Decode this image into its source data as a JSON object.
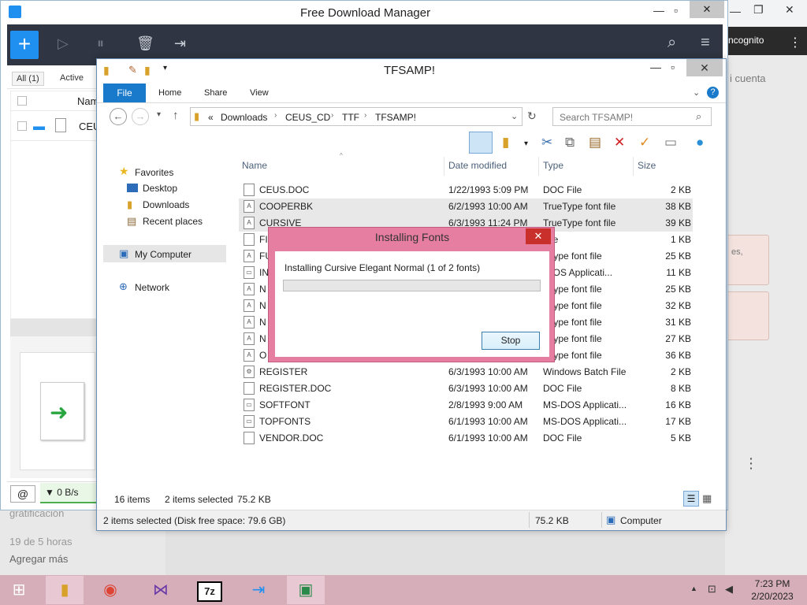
{
  "background": {
    "incognito_label": "ncognito",
    "cuenta_text": "i cuenta",
    "card_comma": "es,",
    "left_text1": "gratificación",
    "left_text2": "19 de 5 horas",
    "left_text3": "Agregar más"
  },
  "fdm": {
    "title": "Free Download Manager",
    "tabs": [
      "All (1)",
      "Active"
    ],
    "column_name": "Nam",
    "download_name": "CEU",
    "speed": "▼ 0 B/s"
  },
  "explorer": {
    "title": "TFSAMP!",
    "ribbon_tabs": {
      "file": "File",
      "home": "Home",
      "share": "Share",
      "view": "View"
    },
    "breadcrumb": [
      "«",
      "Downloads",
      "CEUS_CD",
      "TTF",
      "TFSAMP!"
    ],
    "search_placeholder": "Search TFSAMP!",
    "nav": {
      "favorites": "Favorites",
      "desktop": "Desktop",
      "downloads": "Downloads",
      "recent": "Recent places",
      "computer": "My Computer",
      "network": "Network"
    },
    "columns": {
      "name": "Name",
      "date": "Date modified",
      "type": "Type",
      "size": "Size"
    },
    "files": [
      {
        "name": "CEUS.DOC",
        "date": "1/22/1993 5:09 PM",
        "type": "DOC File",
        "size": "2 KB",
        "selected": false,
        "icon": "doc"
      },
      {
        "name": "COOPERBK",
        "date": "6/2/1993 10:00 AM",
        "type": "TrueType font file",
        "size": "38 KB",
        "selected": true,
        "icon": "font"
      },
      {
        "name": "CURSIVE",
        "date": "6/3/1993 11:24 PM",
        "type": "TrueType font file",
        "size": "39 KB",
        "selected": true,
        "icon": "font"
      },
      {
        "name": "FI",
        "date": "",
        "type": "File",
        "size": "1 KB",
        "selected": false,
        "icon": "doc"
      },
      {
        "name": "FU",
        "date": "",
        "type": "eType font file",
        "size": "25 KB",
        "selected": false,
        "icon": "font"
      },
      {
        "name": "IN",
        "date": "",
        "type": "-DOS Applicati...",
        "size": "11 KB",
        "selected": false,
        "icon": "app"
      },
      {
        "name": "N",
        "date": "",
        "type": "eType font file",
        "size": "25 KB",
        "selected": false,
        "icon": "font"
      },
      {
        "name": "N",
        "date": "",
        "type": "eType font file",
        "size": "32 KB",
        "selected": false,
        "icon": "font"
      },
      {
        "name": "N",
        "date": "",
        "type": "eType font file",
        "size": "31 KB",
        "selected": false,
        "icon": "font"
      },
      {
        "name": "N",
        "date": "",
        "type": "eType font file",
        "size": "27 KB",
        "selected": false,
        "icon": "font"
      },
      {
        "name": "O",
        "date": "",
        "type": "eType font file",
        "size": "36 KB",
        "selected": false,
        "icon": "font"
      },
      {
        "name": "REGISTER",
        "date": "6/3/1993 10:00 AM",
        "type": "Windows Batch File",
        "size": "2 KB",
        "selected": false,
        "icon": "bat"
      },
      {
        "name": "REGISTER.DOC",
        "date": "6/3/1993 10:00 AM",
        "type": "DOC File",
        "size": "8 KB",
        "selected": false,
        "icon": "doc"
      },
      {
        "name": "SOFTFONT",
        "date": "2/8/1993 9:00 AM",
        "type": "MS-DOS Applicati...",
        "size": "16 KB",
        "selected": false,
        "icon": "app"
      },
      {
        "name": "TOPFONTS",
        "date": "6/1/1993 10:00 AM",
        "type": "MS-DOS Applicati...",
        "size": "17 KB",
        "selected": false,
        "icon": "app"
      },
      {
        "name": "VENDOR.DOC",
        "date": "6/1/1993 10:00 AM",
        "type": "DOC File",
        "size": "5 KB",
        "selected": false,
        "icon": "doc"
      }
    ],
    "item_count": "16 items",
    "selected_count": "2 items selected",
    "selected_size": "75.2 KB",
    "bottom_status": "2 items selected (Disk free space: 79.6 GB)",
    "bottom_size": "75.2 KB",
    "bottom_location": "Computer"
  },
  "dialog": {
    "title": "Installing Fonts",
    "message": "Installing Cursive Elegant Normal (1 of 2 fonts)",
    "progress": 0,
    "stop_label": "Stop"
  },
  "taskbar": {
    "time": "7:23 PM",
    "date": "2/20/2023"
  },
  "colors": {
    "fdm_toolbar": "#2f3542",
    "fdm_accent": "#1f8ff0",
    "dialog_frame": "#e67ea2",
    "taskbar": "#d5aeba",
    "ribbon_file": "#1979ca"
  }
}
